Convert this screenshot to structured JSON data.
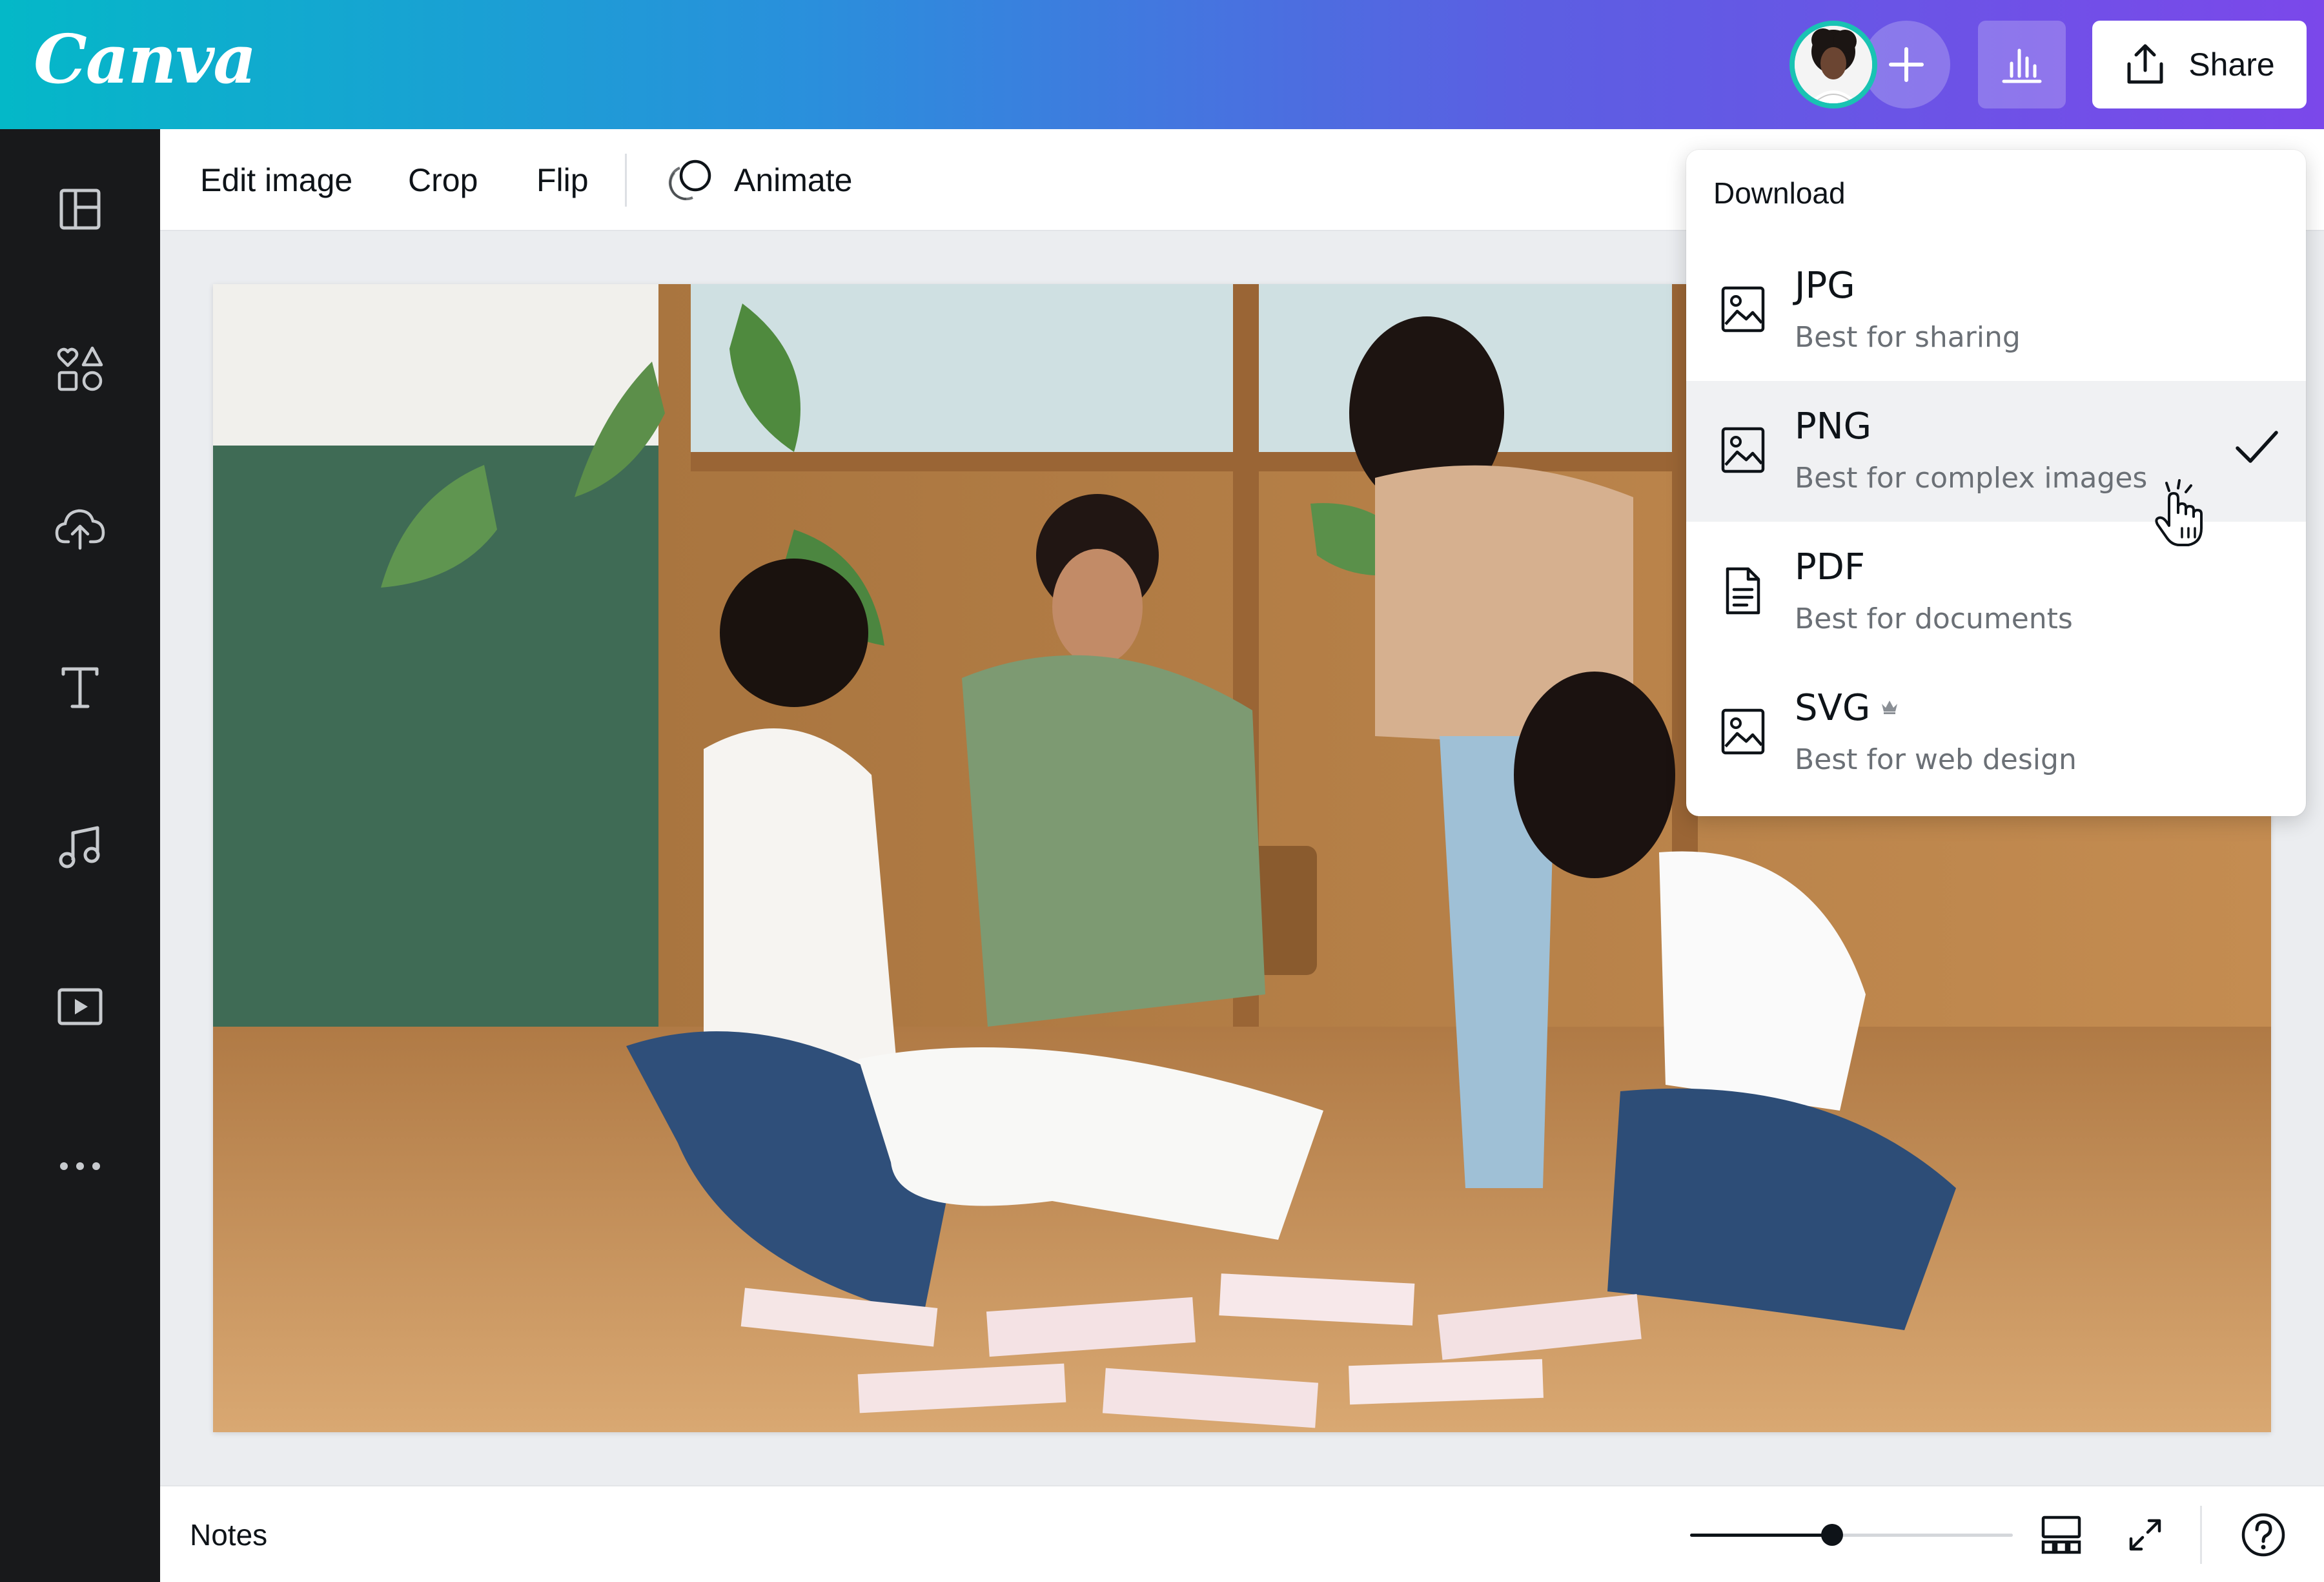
{
  "header": {
    "logo_text": "Canva",
    "share_label": "Share",
    "gradient": [
      "#04b8c8",
      "#2a8fdc",
      "#5b5fe2",
      "#7b48ea"
    ]
  },
  "sidebar": {
    "items": [
      {
        "icon": "layout-icon"
      },
      {
        "icon": "elements-icon"
      },
      {
        "icon": "upload-icon"
      },
      {
        "icon": "text-icon"
      },
      {
        "icon": "audio-icon"
      },
      {
        "icon": "video-icon"
      },
      {
        "icon": "more-icon"
      }
    ]
  },
  "toolbar": {
    "edit_image": "Edit image",
    "crop": "Crop",
    "flip": "Flip",
    "animate": "Animate"
  },
  "download_menu": {
    "title": "Download",
    "selected": "PNG",
    "options": [
      {
        "label": "JPG",
        "description": "Best for sharing",
        "icon": "image-icon"
      },
      {
        "label": "PNG",
        "description": "Best for complex images",
        "icon": "image-icon"
      },
      {
        "label": "PDF",
        "description": "Best for documents",
        "icon": "document-icon"
      },
      {
        "label": "SVG",
        "description": "Best for web design",
        "icon": "image-icon",
        "pro": true
      }
    ]
  },
  "bottom_bar": {
    "notes_label": "Notes",
    "zoom_fraction": 0.44
  },
  "canvas": {
    "image": "photo of four people crouching around papers on a wooden floor"
  }
}
